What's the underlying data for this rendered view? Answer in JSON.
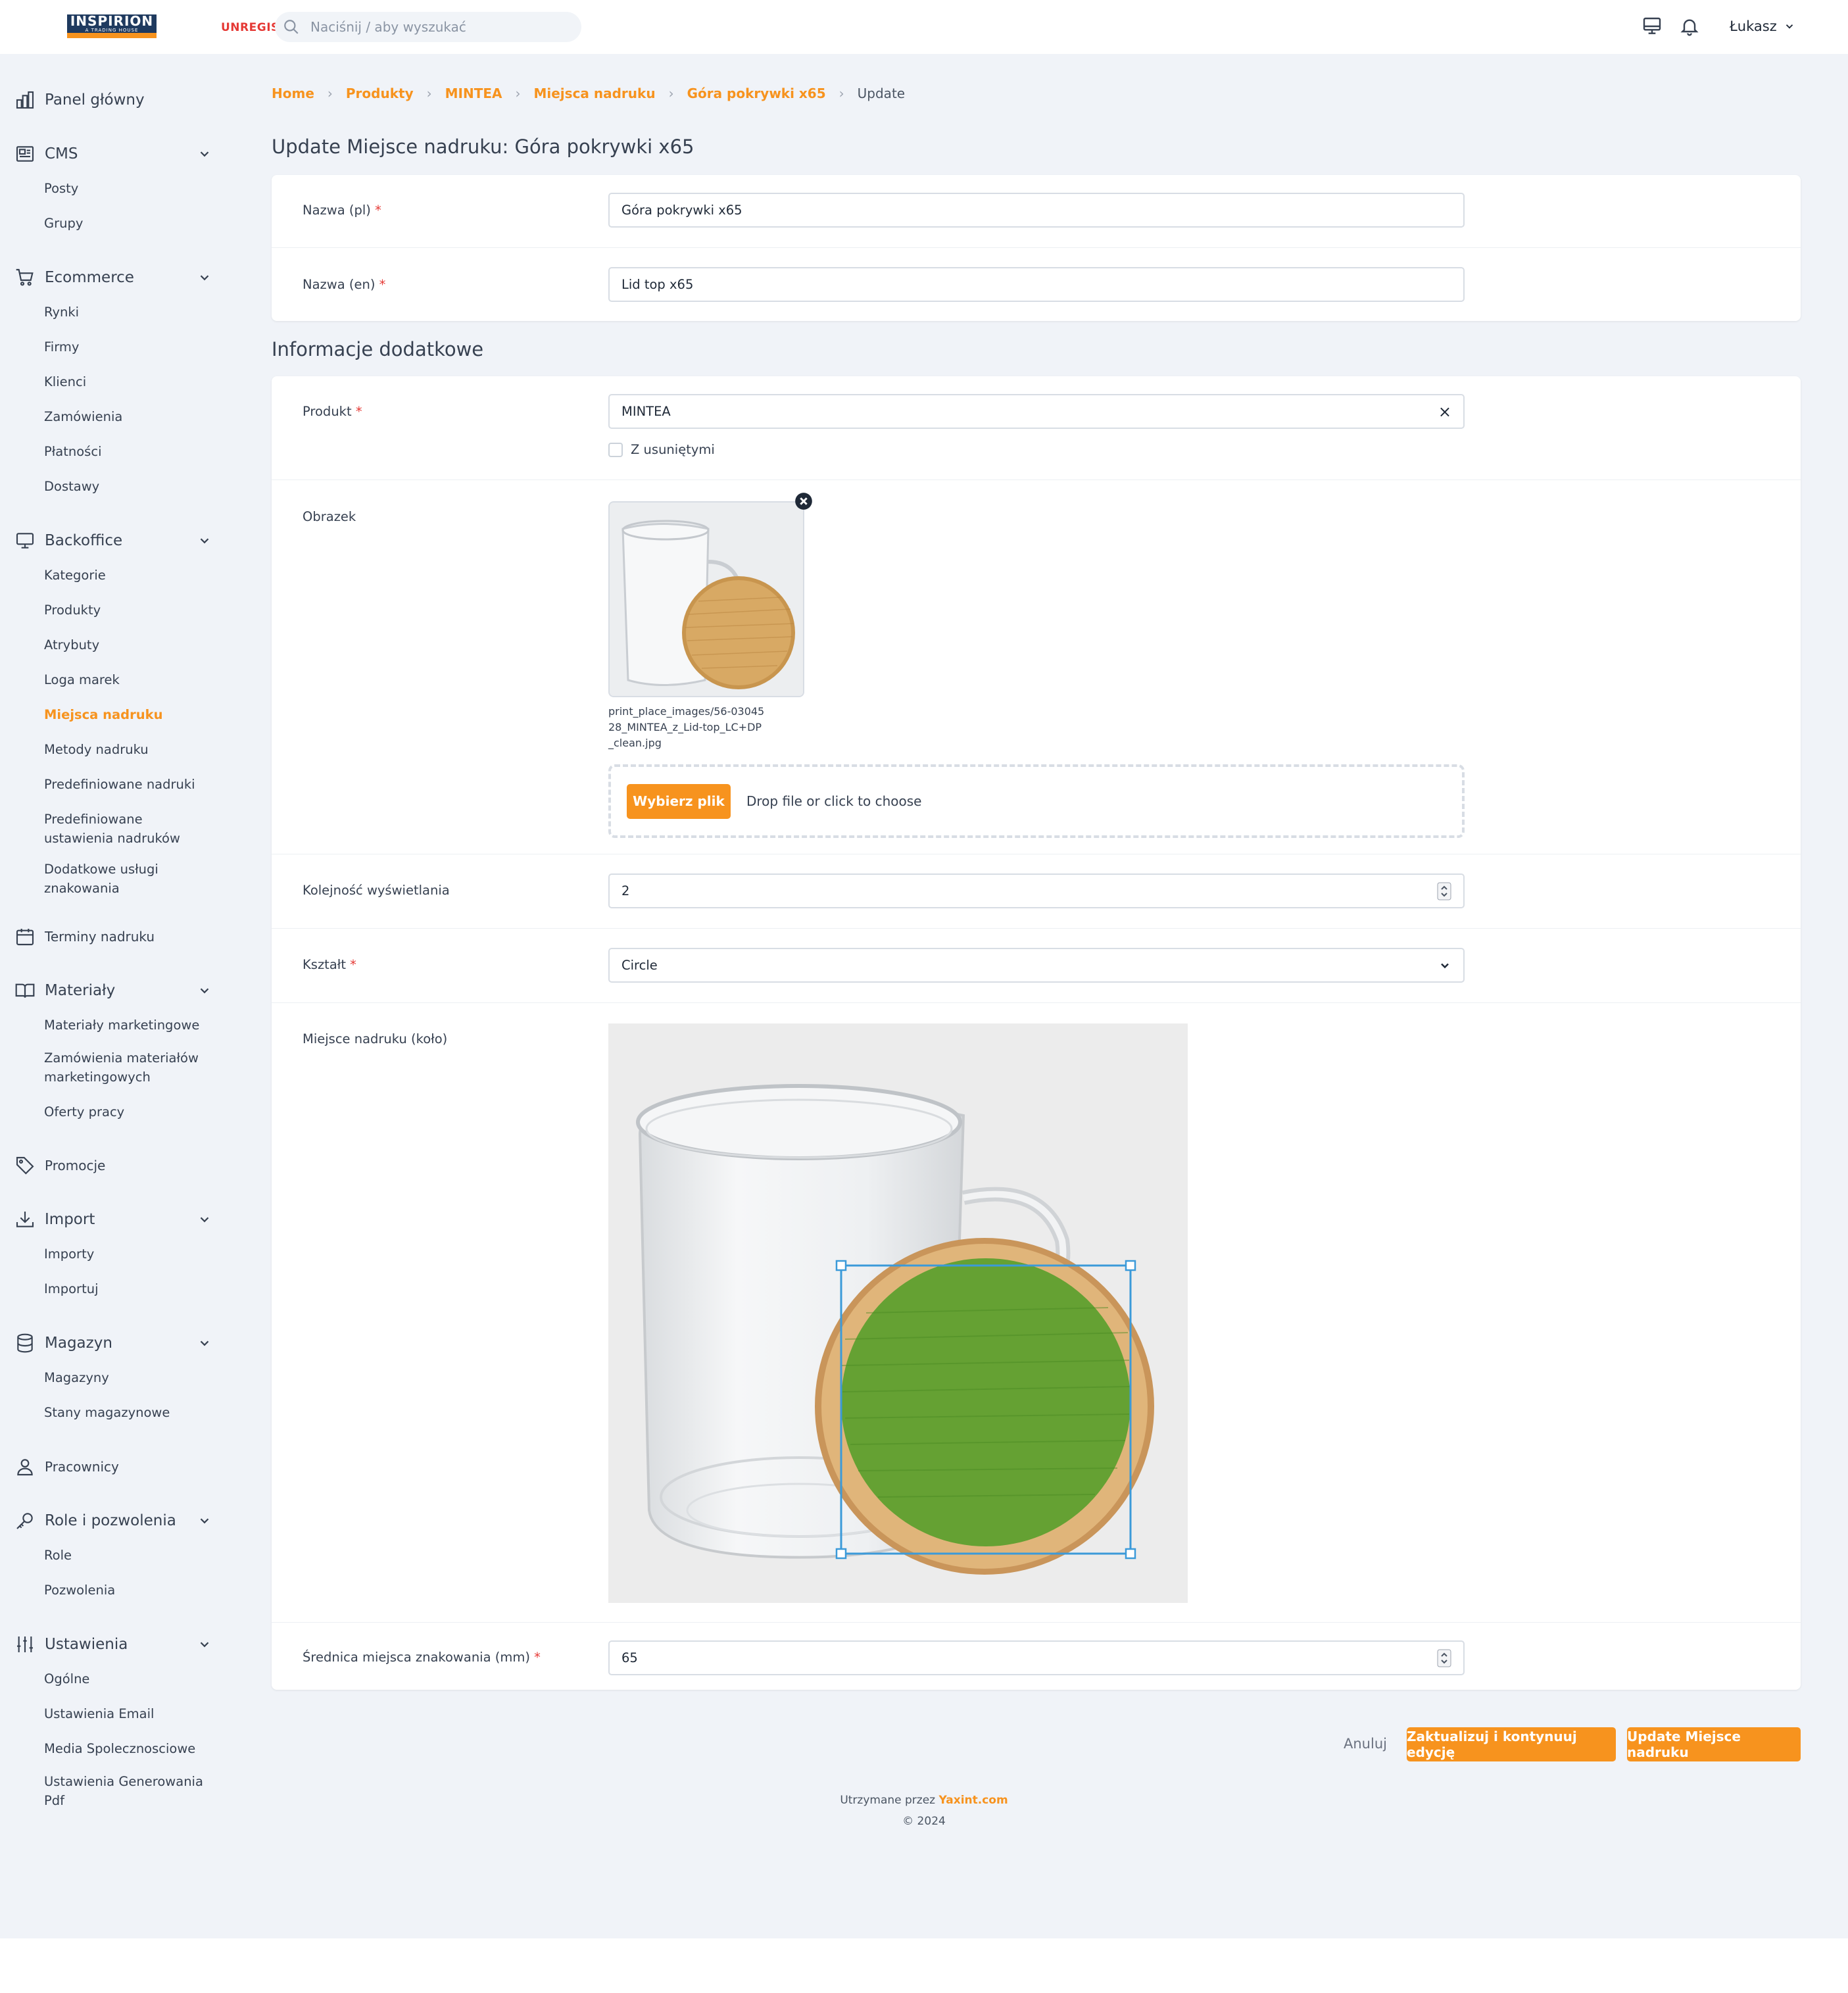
{
  "header": {
    "logo_main": "INSPIRION",
    "logo_sub": "A TRADING HOUSE",
    "unregistered_badge": "UNREGIS",
    "search_placeholder": "Naciśnij / aby wyszukać",
    "user_name": "Łukasz"
  },
  "sidebar": {
    "dashboard": "Panel główny",
    "cms": {
      "label": "CMS",
      "items": [
        "Posty",
        "Grupy"
      ]
    },
    "ecommerce": {
      "label": "Ecommerce",
      "items": [
        "Rynki",
        "Firmy",
        "Klienci",
        "Zamówienia",
        "Płatności",
        "Dostawy"
      ]
    },
    "backoffice": {
      "label": "Backoffice",
      "items": [
        "Kategorie",
        "Produkty",
        "Atrybuty",
        "Loga marek",
        "Miejsca nadruku",
        "Metody nadruku",
        "Predefiniowane nadruki",
        "Predefiniowane ustawienia nadruków",
        "Dodatkowe usługi znakowania"
      ]
    },
    "print_dates": "Terminy nadruku",
    "materials": {
      "label": "Materiały",
      "items": [
        "Materiały marketingowe",
        "Zamówienia materiałów marketingowych",
        "Oferty pracy"
      ]
    },
    "promotions": "Promocje",
    "import": {
      "label": "Import",
      "items": [
        "Importy",
        "Importuj"
      ]
    },
    "warehouse": {
      "label": "Magazyn",
      "items": [
        "Magazyny",
        "Stany magazynowe"
      ]
    },
    "employees": "Pracownicy",
    "roles": {
      "label": "Role i pozwolenia",
      "items": [
        "Role",
        "Pozwolenia"
      ]
    },
    "settings": {
      "label": "Ustawienia",
      "items": [
        "Ogólne",
        "Ustawienia Email",
        "Media Spolecznosciowe",
        "Ustawienia Generowania Pdf"
      ]
    }
  },
  "breadcrumb": [
    "Home",
    "Produkty",
    "MINTEA",
    "Miejsca nadruku",
    "Góra pokrywki x65",
    "Update"
  ],
  "page_title": "Update Miejsce nadruku: Góra pokrywki x65",
  "section_title": "Informacje dodatkowe",
  "form": {
    "name_pl": {
      "label": "Nazwa (pl)",
      "value": "Góra pokrywki x65"
    },
    "name_en": {
      "label": "Nazwa (en)",
      "value": "Lid top x65"
    },
    "product": {
      "label": "Produkt",
      "value": "MINTEA",
      "clear": "×"
    },
    "with_deleted": "Z usuniętymi",
    "image": {
      "label": "Obrazek",
      "filename": "print_place_images/56-0304528_MINTEA_z_Lid-top_LC+DP_clean.jpg"
    },
    "upload": {
      "button": "Wybierz plik",
      "hint": "Drop file or click to choose"
    },
    "display_order": {
      "label": "Kolejność wyświetlania",
      "value": "2"
    },
    "shape": {
      "label": "Kształt",
      "value": "Circle"
    },
    "print_area": {
      "label": "Miejsce nadruku (koło)"
    },
    "diameter": {
      "label": "Średnica miejsca znakowania (mm)",
      "value": "65"
    },
    "required_mark": "*"
  },
  "actions": {
    "cancel": "Anuluj",
    "update_continue": "Zaktualizuj i kontynuuj edycję",
    "update": "Update Miejsce nadruku"
  },
  "footer": {
    "maintained_by": "Utrzymane przez",
    "brand": "Yaxint.com",
    "copyright": "© 2024"
  },
  "colors": {
    "accent": "#f7931e",
    "required": "#e53935",
    "background": "#f0f3f8",
    "selection": "#3b9ad9",
    "print_overlay": "#5aa02c"
  }
}
